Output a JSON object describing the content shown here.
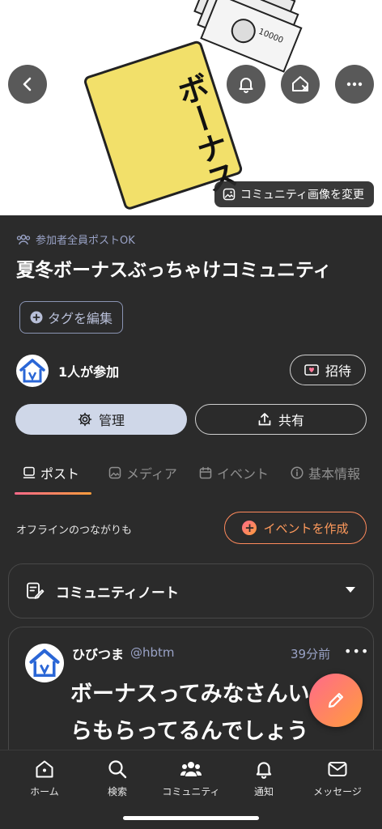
{
  "header": {
    "illustration": {
      "envelope_text": "ボーナス",
      "bill_text": "10000"
    },
    "buttons": {
      "back": "back-icon",
      "bell": "bell-icon",
      "leave": "leave-home-icon",
      "more": "more-icon"
    },
    "change_image_label": "コミュニティ画像を変更"
  },
  "community": {
    "permission_label": "参加者全員ポストOK",
    "title": "夏冬ボーナスぶっちゃけコミュニティ",
    "tag_edit_label": "タグを編集",
    "members_label": "1人が参加",
    "invite_label": "招待",
    "manage_label": "管理",
    "share_label": "共有"
  },
  "tabs": [
    {
      "label": "ポスト",
      "icon": "post-icon",
      "active": true
    },
    {
      "label": "メディア",
      "icon": "media-icon",
      "active": false
    },
    {
      "label": "イベント",
      "icon": "calendar-icon",
      "active": false
    },
    {
      "label": "基本情報",
      "icon": "info-icon",
      "active": false
    }
  ],
  "events": {
    "offline_text": "オフラインのつながりも",
    "create_label": "イベントを作成"
  },
  "note": {
    "label": "コミュニティノート"
  },
  "post": {
    "user_name": "ひびつま",
    "handle": "@hbtm",
    "time": "39分前",
    "more": "•••",
    "body_line1": "ボーナスってみなさんい",
    "body_line2": "らもらってるんでしょう"
  },
  "bottom_nav": [
    {
      "label": "ホーム",
      "icon": "home-icon"
    },
    {
      "label": "検索",
      "icon": "search-icon"
    },
    {
      "label": "コミュニティ",
      "icon": "community-icon"
    },
    {
      "label": "通知",
      "icon": "bell-icon"
    },
    {
      "label": "メッセージ",
      "icon": "mail-icon"
    }
  ],
  "colors": {
    "background": "#2b2b2b",
    "accent_gradient_start": "#ff6a8a",
    "accent_gradient_end": "#ff9d3c",
    "secondary_text": "#9aa3c7"
  }
}
